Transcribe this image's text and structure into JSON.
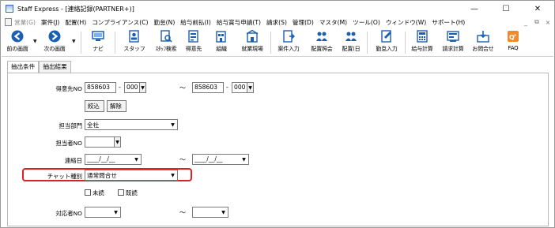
{
  "window": {
    "title": "Staff Express - [連絡記録(PARTNER+)]",
    "controls": {
      "minimize": "—",
      "maximize": "☐",
      "close": "✕"
    }
  },
  "menu": {
    "items": [
      {
        "label": "営業(G)",
        "disabled": true
      },
      {
        "label": "案件(J)",
        "disabled": false
      },
      {
        "label": "配置(H)",
        "disabled": false
      },
      {
        "label": "コンプライアンス(C)",
        "disabled": false
      },
      {
        "label": "勤怠(N)",
        "disabled": false
      },
      {
        "label": "給与前払(I)",
        "disabled": false
      },
      {
        "label": "給与賞与申請(T)",
        "disabled": false
      },
      {
        "label": "請求(S)",
        "disabled": false
      },
      {
        "label": "管理(D)",
        "disabled": false
      },
      {
        "label": "マスタ(M)",
        "disabled": false
      },
      {
        "label": "ツール(O)",
        "disabled": false
      },
      {
        "label": "ウィンドウ(W)",
        "disabled": false
      },
      {
        "label": "サポート(H)",
        "disabled": false
      }
    ],
    "mdi": {
      "minimize": "_",
      "restore": "⧉",
      "close": "×"
    }
  },
  "toolbar": {
    "back": "前の画面",
    "forward": "次の画面",
    "navi": "ナビ",
    "staff": "スタッフ",
    "staff_search": "ｽﾀｯﾌ検索",
    "client": "得意先",
    "org": "組織",
    "site": "就業現場",
    "job_entry": "案件入力",
    "placement_inquiry": "配置照会",
    "placement_day": "配置(日",
    "attendance": "勤怠入力",
    "payroll": "給与計算",
    "billing": "請求計算",
    "contact": "お問合せ",
    "faq": "FAQ"
  },
  "tabs": {
    "criteria": "抽出条件",
    "results": "抽出結果"
  },
  "form": {
    "client_no_label": "得意先NO",
    "client_no_from": "858603",
    "client_branch_from": "000",
    "client_no_to": "858603",
    "client_branch_to": "000",
    "range_sep": "～",
    "dash": "-",
    "narrow_button": "絞込",
    "clear_button": "解除",
    "dept_label": "担当部門",
    "dept_value": "全社",
    "person_label": "担当者NO",
    "date_label": "連絡日",
    "date_placeholder": "____/__/__",
    "chat_type_label": "チャット種別",
    "chat_type_value": "通常問合せ",
    "unread_label": "未読",
    "read_label": "既読",
    "responder_label": "対応者NO"
  },
  "colors": {
    "highlight": "#e0201e",
    "toolbar_blue": "#1b5fb3"
  }
}
